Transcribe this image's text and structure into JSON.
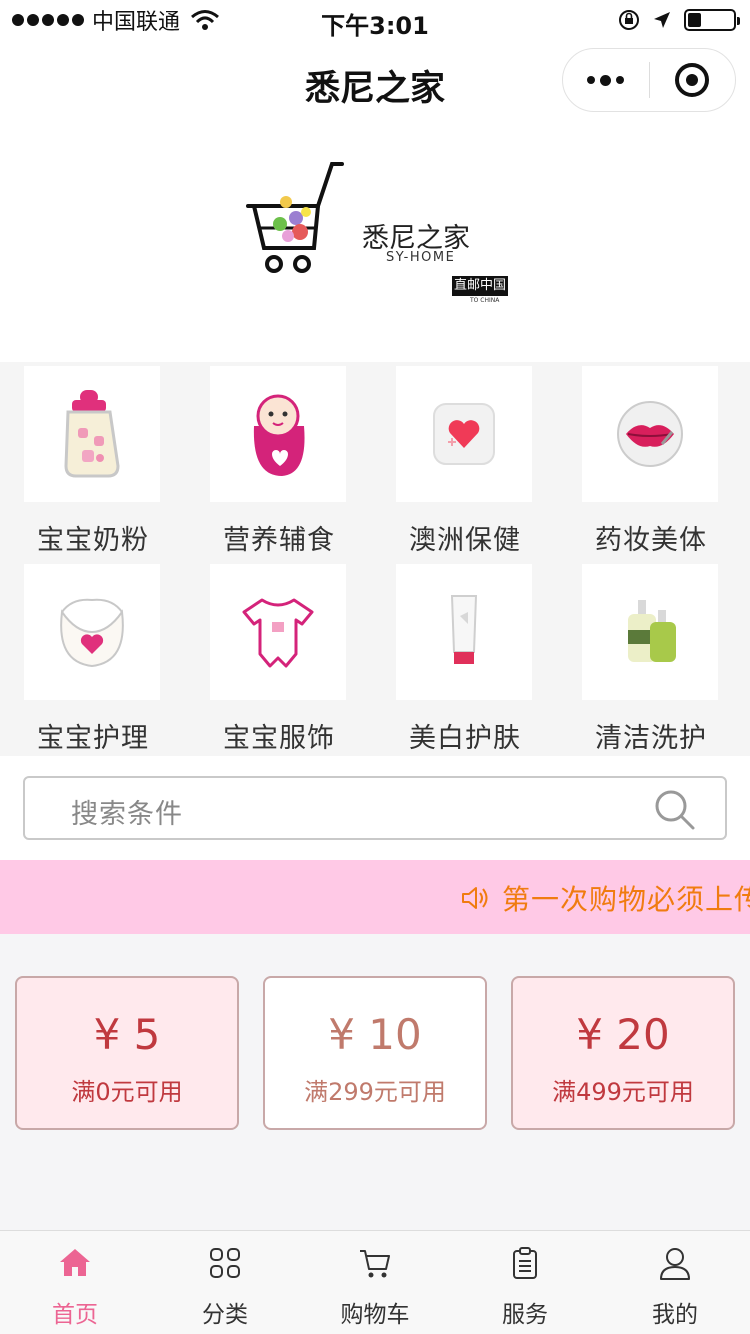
{
  "status_bar": {
    "carrier": "中国联通",
    "time": "下午3:01",
    "battery_level": 0.3
  },
  "nav": {
    "title": "悉尼之家"
  },
  "banner": {
    "brand_name": "悉尼之家",
    "brand_sub": "SY-HOME",
    "stamp_text": "直邮中国",
    "stamp_sub": "TO CHINA"
  },
  "categories": [
    {
      "label": "宝宝奶粉",
      "icon": "baby-bottle-icon"
    },
    {
      "label": "营养辅食",
      "icon": "baby-swaddle-icon"
    },
    {
      "label": "澳洲保健",
      "icon": "health-heart-icon"
    },
    {
      "label": "药妆美体",
      "icon": "lips-badge-icon"
    },
    {
      "label": "宝宝护理",
      "icon": "bib-icon"
    },
    {
      "label": "宝宝服饰",
      "icon": "onesie-icon"
    },
    {
      "label": "美白护肤",
      "icon": "cream-tube-icon"
    },
    {
      "label": "清洁洗护",
      "icon": "soap-bottles-icon"
    }
  ],
  "search": {
    "placeholder": "搜索条件"
  },
  "notice": {
    "text": "第一次购物必须上传"
  },
  "coupons": [
    {
      "amount": "¥ 5",
      "condition": "满0元可用"
    },
    {
      "amount": "¥ 10",
      "condition": "满299元可用"
    },
    {
      "amount": "¥ 20",
      "condition": "满499元可用"
    }
  ],
  "tabs": [
    {
      "label": "首页",
      "icon": "home-icon"
    },
    {
      "label": "分类",
      "icon": "grid-icon"
    },
    {
      "label": "购物车",
      "icon": "cart-icon"
    },
    {
      "label": "服务",
      "icon": "clipboard-icon"
    },
    {
      "label": "我的",
      "icon": "user-icon"
    }
  ],
  "colors": {
    "accent": "#ec6593",
    "notice_bg": "#ffc9e6",
    "notice_text": "#f07c10",
    "coupon_pink_bg": "#ffe9ed",
    "coupon_red": "#c0393f"
  }
}
